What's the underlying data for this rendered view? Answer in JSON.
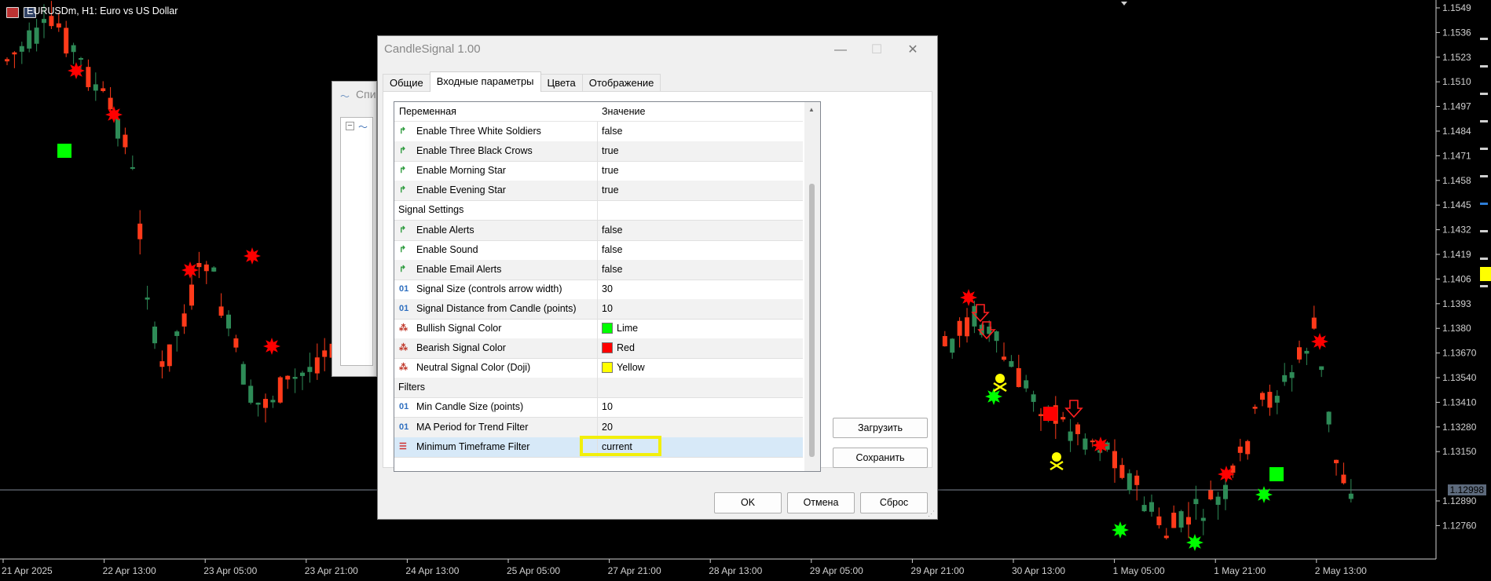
{
  "chart": {
    "title": "EURUSDm, H1:  Euro vs US Dollar",
    "price_levels": [
      "1.1549",
      "1.1536",
      "1.1523",
      "1.1510",
      "1.1497",
      "1.1484",
      "1.1471",
      "1.1458",
      "1.1445",
      "1.1432",
      "1.1419",
      "1.1406",
      "1.1393",
      "1.1380",
      "1.13670",
      "1.13540",
      "1.13410",
      "1.13280",
      "1.13150",
      "1.12890",
      "1.12760"
    ],
    "current_price": "1.12998",
    "time_labels": [
      "21 Apr 2025",
      "22 Apr 13:00",
      "23 Apr 05:00",
      "23 Apr 21:00",
      "24 Apr 13:00",
      "25 Apr 05:00",
      "27 Apr 21:00",
      "28 Apr 13:00",
      "29 Apr 05:00",
      "29 Apr 21:00",
      "30 Apr 13:00",
      "1 May 05:00",
      "1 May 21:00",
      "2 May 13:00"
    ],
    "colors": {
      "bull": "#2e8b57",
      "bear": "#ff3a1a",
      "bullish_signal": "#00ff00",
      "bearish_signal": "#ff0000",
      "doji": "#ffff00"
    }
  },
  "background_dialog": {
    "title": "Спи",
    "tree_icon": "minus-square-icon"
  },
  "dialog": {
    "title": "CandleSignal 1.00",
    "tabs": [
      {
        "label": "Общие"
      },
      {
        "label": "Входные параметры",
        "active": true
      },
      {
        "label": "Цвета"
      },
      {
        "label": "Отображение"
      }
    ],
    "grid": {
      "headers": {
        "variable": "Переменная",
        "value": "Значение"
      },
      "rows": [
        {
          "icon": "arrow-param-icon",
          "name": "Enable Three White Soldiers",
          "value": "false"
        },
        {
          "icon": "arrow-param-icon",
          "name": "Enable Three Black Crows",
          "value": "true"
        },
        {
          "icon": "arrow-param-icon",
          "name": "Enable Morning Star",
          "value": "true"
        },
        {
          "icon": "arrow-param-icon",
          "name": "Enable Evening Star",
          "value": "true"
        },
        {
          "group": true,
          "name": "Signal Settings",
          "value": ""
        },
        {
          "icon": "arrow-param-icon",
          "name": "Enable Alerts",
          "value": "false"
        },
        {
          "icon": "arrow-param-icon",
          "name": "Enable Sound",
          "value": "false"
        },
        {
          "icon": "arrow-param-icon",
          "name": "Enable Email Alerts",
          "value": "false"
        },
        {
          "icon": "number-param-icon",
          "name": "Signal Size (controls arrow width)",
          "value": "30"
        },
        {
          "icon": "number-param-icon",
          "name": "Signal Distance from Candle (points)",
          "value": "10"
        },
        {
          "icon": "color-param-icon",
          "name": "Bullish Signal Color",
          "value": "Lime",
          "swatch": "#00ff00"
        },
        {
          "icon": "color-param-icon",
          "name": "Bearish Signal Color",
          "value": "Red",
          "swatch": "#ff0000"
        },
        {
          "icon": "color-param-icon",
          "name": "Neutral Signal Color (Doji)",
          "value": "Yellow",
          "swatch": "#ffff00"
        },
        {
          "group": true,
          "name": "Filters",
          "value": ""
        },
        {
          "icon": "number-param-icon",
          "name": "Min Candle Size (points)",
          "value": "10"
        },
        {
          "icon": "number-param-icon",
          "name": "MA Period for Trend Filter",
          "value": "20"
        },
        {
          "icon": "enum-param-icon",
          "name": "Minimum Timeframe Filter",
          "value": "current",
          "selected": true
        }
      ]
    },
    "buttons": {
      "load": "Загрузить",
      "save": "Сохранить",
      "ok": "OK",
      "cancel": "Отмена",
      "reset": "Сброс"
    }
  }
}
